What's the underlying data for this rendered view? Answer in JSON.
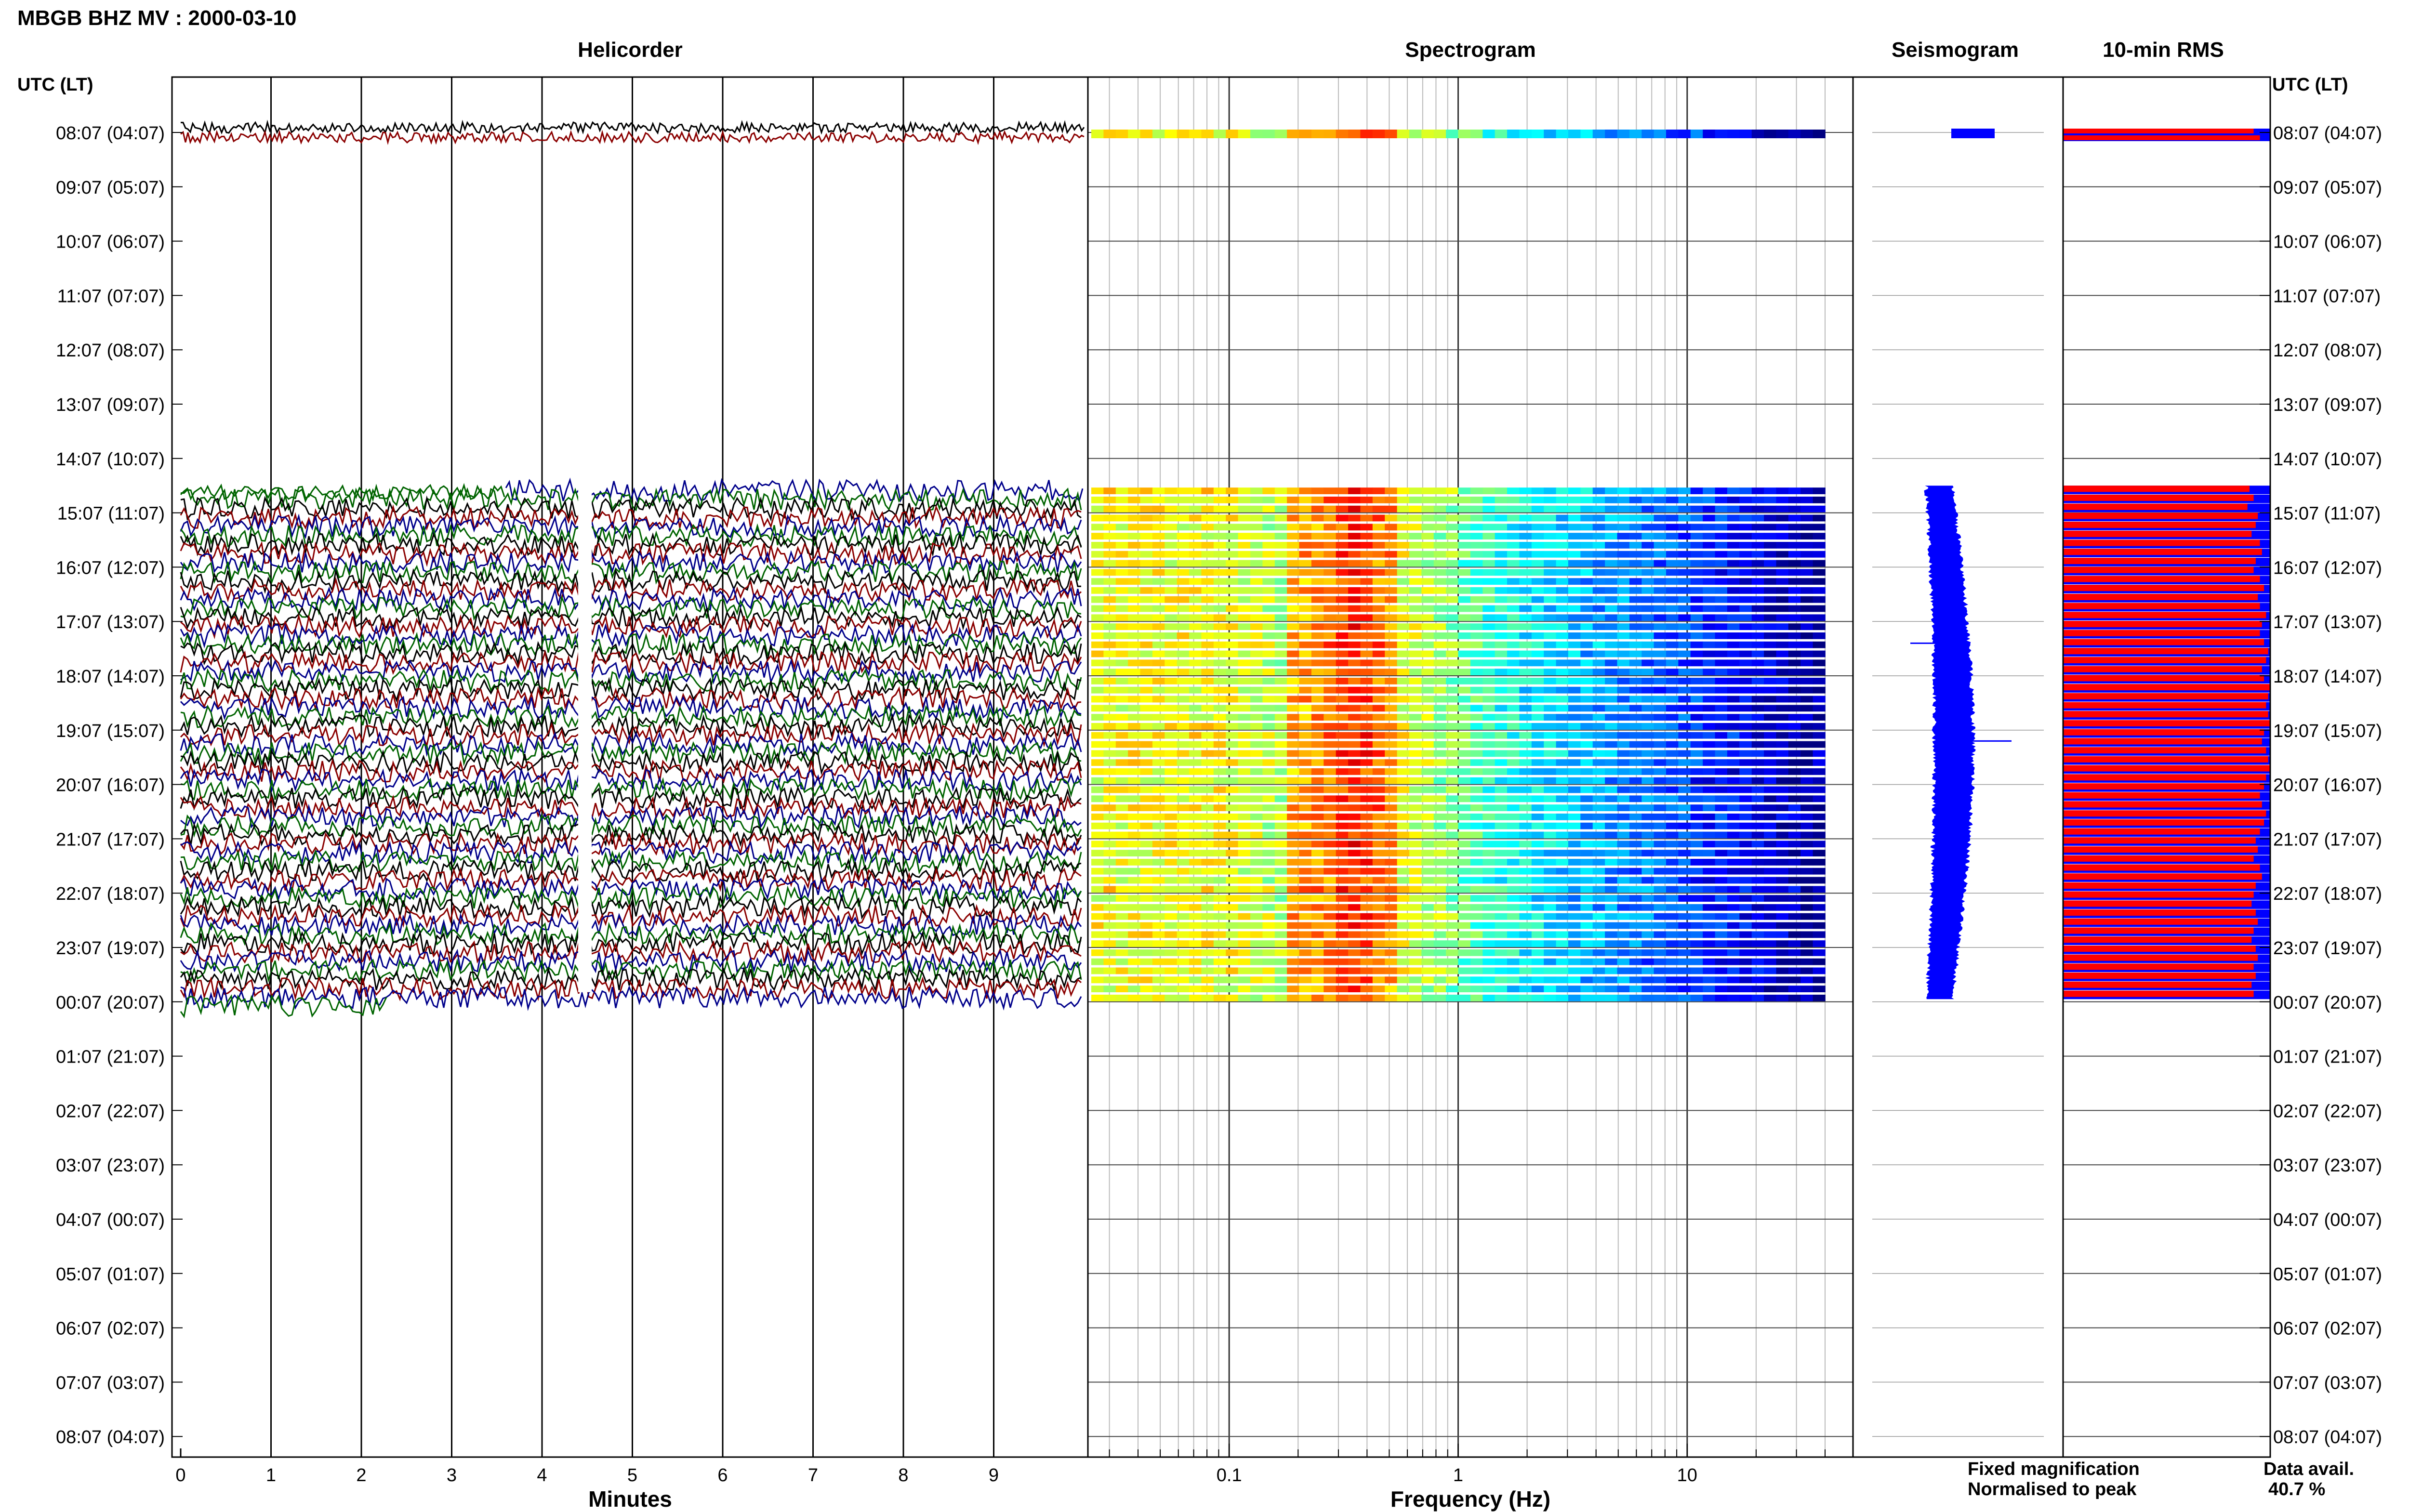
{
  "title": "MBGB BHZ MV : 2000-03-10",
  "panels": {
    "helicorder": "Helicorder",
    "spectrogram": "Spectrogram",
    "seismogram": "Seismogram",
    "rms": "10-min RMS"
  },
  "time_axis": {
    "header": "UTC (LT)",
    "labels": [
      "08:07 (04:07)",
      "09:07 (05:07)",
      "10:07 (06:07)",
      "11:07 (07:07)",
      "12:07 (08:07)",
      "13:07 (09:07)",
      "14:07 (10:07)",
      "15:07 (11:07)",
      "16:07 (12:07)",
      "17:07 (13:07)",
      "18:07 (14:07)",
      "19:07 (15:07)",
      "20:07 (16:07)",
      "21:07 (17:07)",
      "22:07 (18:07)",
      "23:07 (19:07)",
      "00:07 (20:07)",
      "01:07 (21:07)",
      "02:07 (22:07)",
      "03:07 (23:07)",
      "04:07 (00:07)",
      "05:07 (01:07)",
      "06:07 (02:07)",
      "07:07 (03:07)",
      "08:07 (04:07)"
    ]
  },
  "helicorder_axis": {
    "label": "Minutes",
    "ticks": [
      "0",
      "1",
      "2",
      "3",
      "4",
      "5",
      "6",
      "7",
      "8",
      "9"
    ],
    "trace_colors": [
      "#000000",
      "#8b0000",
      "#00008b",
      "#006400"
    ]
  },
  "spectrogram_axis": {
    "label": "Frequency (Hz)",
    "scale": "log",
    "ticks": [
      "0.1",
      "1",
      "10"
    ],
    "range_hz": [
      0.025,
      40
    ]
  },
  "legend": {
    "fixed": "Fixed magnification",
    "normalised": "Normalised to peak",
    "fixed_color": "#0000ff",
    "normalised_color": "#ff0000"
  },
  "data_avail": {
    "label": "Data avail.",
    "value": "40.7 %"
  },
  "chart_data": {
    "type": "heatmap",
    "recording": {
      "first_block": {
        "start_hour": 0.0,
        "end_hour": 0.1
      },
      "second_block": {
        "start_hour": 6.5,
        "end_hour": 15.96
      },
      "missing_minutes": [
        4.4,
        4.55
      ]
    },
    "seismogram_envelope": [
      {
        "hour": 6.5,
        "amp": 0.13
      },
      {
        "hour": 8.0,
        "amp": 0.3
      },
      {
        "hour": 9.5,
        "amp": 0.44
      },
      {
        "hour": 11.2,
        "amp": 0.55
      },
      {
        "hour": 13.0,
        "amp": 0.46
      },
      {
        "hour": 14.5,
        "amp": 0.28
      },
      {
        "hour": 15.9,
        "amp": 0.12
      }
    ],
    "rms_normalised": [
      0.9,
      0.92,
      0.89,
      0.94,
      0.93,
      0.91,
      0.95,
      0.96,
      0.93,
      0.92,
      0.95,
      0.97,
      0.94,
      0.95,
      0.98,
      0.96,
      0.95,
      0.97,
      0.99,
      0.98,
      0.96,
      0.97,
      1.0,
      0.99,
      0.98,
      0.99,
      1.0,
      0.97,
      0.96,
      0.98,
      0.99,
      1.0,
      0.98,
      0.97,
      0.95,
      0.96,
      0.98,
      0.97,
      0.95,
      0.93,
      0.94,
      0.92,
      0.95,
      0.96,
      0.93,
      0.92,
      0.91,
      0.93,
      0.94,
      0.92,
      0.91,
      0.93,
      0.94,
      0.92,
      0.93,
      0.91,
      0.92
    ]
  }
}
